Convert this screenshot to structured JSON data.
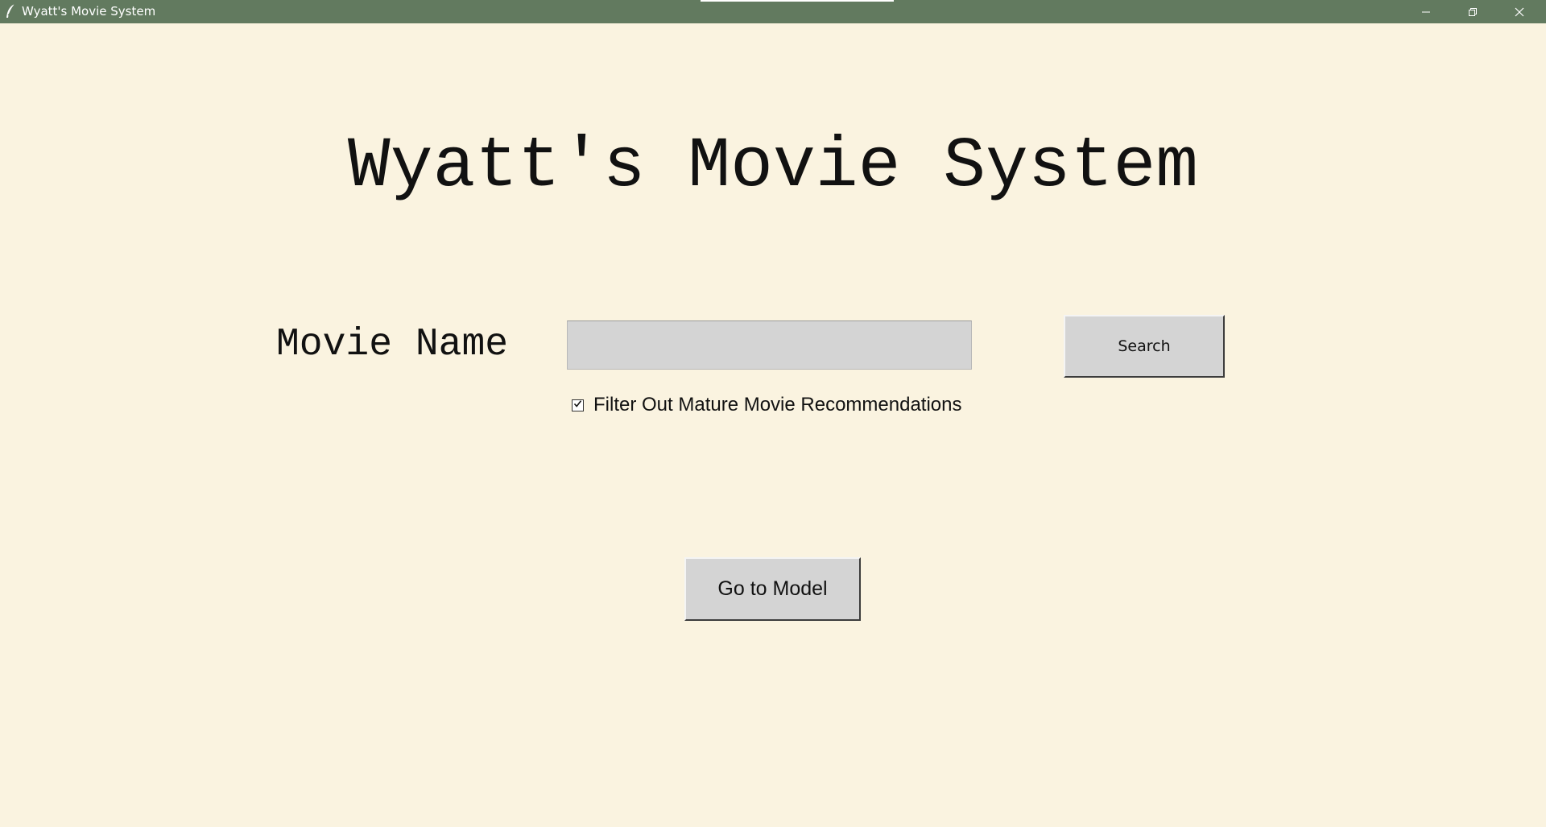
{
  "window": {
    "title": "Wyatt's Movie System",
    "titlebar_color": "#627a5f",
    "background_color": "#faf3e0"
  },
  "main": {
    "heading": "Wyatt's Movie System",
    "movie_label": "Movie Name",
    "movie_input_value": "",
    "search_label": "Search",
    "filter_checked": true,
    "filter_label": "Filter Out Mature Movie Recommendations",
    "goto_label": "Go to Model"
  },
  "icons": {
    "app": "feather-icon",
    "minimize": "minimize-icon",
    "maximize": "restore-icon",
    "close": "close-icon",
    "checkbox": "checkmark-icon"
  }
}
